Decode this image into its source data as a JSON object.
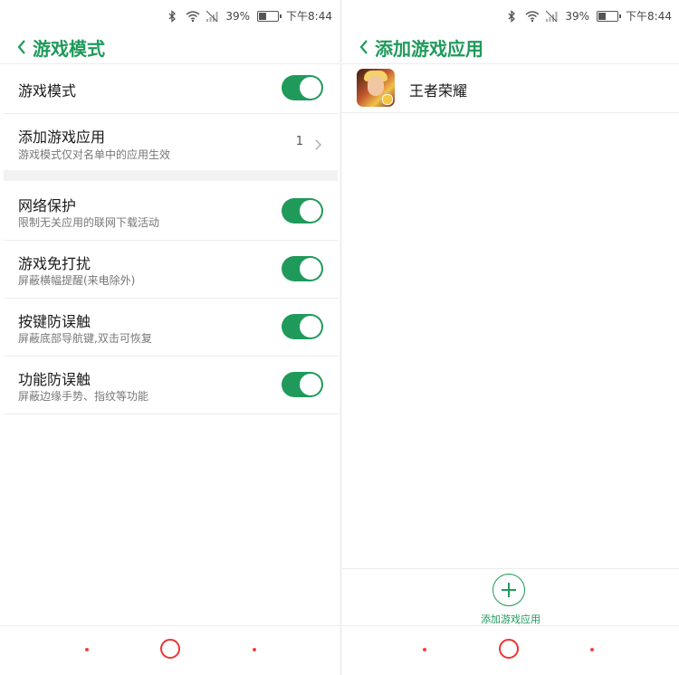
{
  "status_bar": {
    "battery_percent": "39%",
    "time": "下午8:44",
    "battery_level": 0.39
  },
  "left": {
    "header_title": "游戏模式",
    "rows": [
      {
        "main": "游戏模式",
        "toggle_on": true
      },
      {
        "main": "添加游戏应用",
        "sub": "游戏模式仅对名单中的应用生效",
        "count": "1"
      },
      {
        "main": "网络保护",
        "sub": "限制无关应用的联网下载活动",
        "toggle_on": true
      },
      {
        "main": "游戏免打扰",
        "sub": "屏蔽横幅提醒(来电除外)",
        "toggle_on": true
      },
      {
        "main": "按键防误触",
        "sub": "屏蔽底部导航键,双击可恢复",
        "toggle_on": true
      },
      {
        "main": "功能防误触",
        "sub": "屏蔽边缘手势、指纹等功能",
        "toggle_on": true
      }
    ]
  },
  "right": {
    "header_title": "添加游戏应用",
    "apps": [
      {
        "name": "王者荣耀",
        "icon": "honor-of-kings-app-icon"
      }
    ],
    "add_button_label": "添加游戏应用"
  },
  "colors": {
    "accent": "#1f9a5a",
    "nav_accent": "#e33333"
  }
}
